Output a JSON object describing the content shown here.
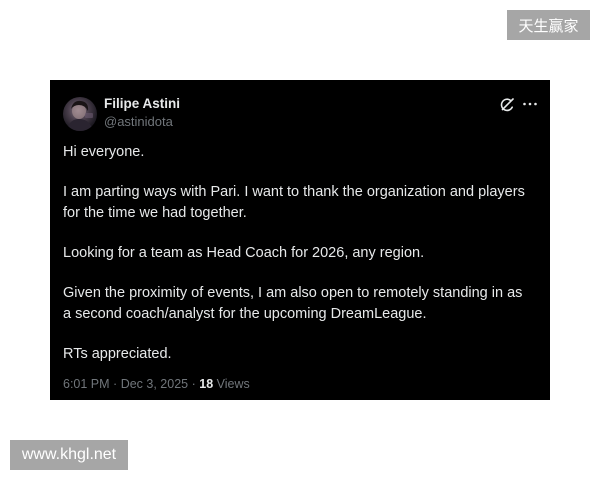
{
  "watermarks": {
    "top_right": "天生赢家",
    "bottom_left": "www.khgl.net"
  },
  "tweet": {
    "author_name": "Filipe Astini",
    "author_handle": "@astinidota",
    "paragraphs": [
      [
        "Hi everyone."
      ],
      [
        "I am parting ways with Pari. I want to thank the organization and players",
        "for the time we had together."
      ],
      [
        "Looking for a team as Head Coach for 2026, any region."
      ],
      [
        "Given the proximity of events, I am also open to remotely standing in as",
        "a second coach/analyst for the upcoming DreamLeague."
      ],
      [
        "RTs appreciated."
      ]
    ],
    "footer": {
      "time": "6:01 PM",
      "separator": "·",
      "date": "Dec 3, 2025",
      "views_count": "18",
      "views_label": "Views"
    }
  },
  "icons": {
    "header_actions": [
      "grok-icon",
      "more-icon"
    ]
  },
  "colors": {
    "card_background": "#000000",
    "primary_text": "#e7e9ea",
    "secondary_text": "#71767b",
    "page_background": "#ffffff",
    "watermark_background": "#a6a6a6"
  }
}
